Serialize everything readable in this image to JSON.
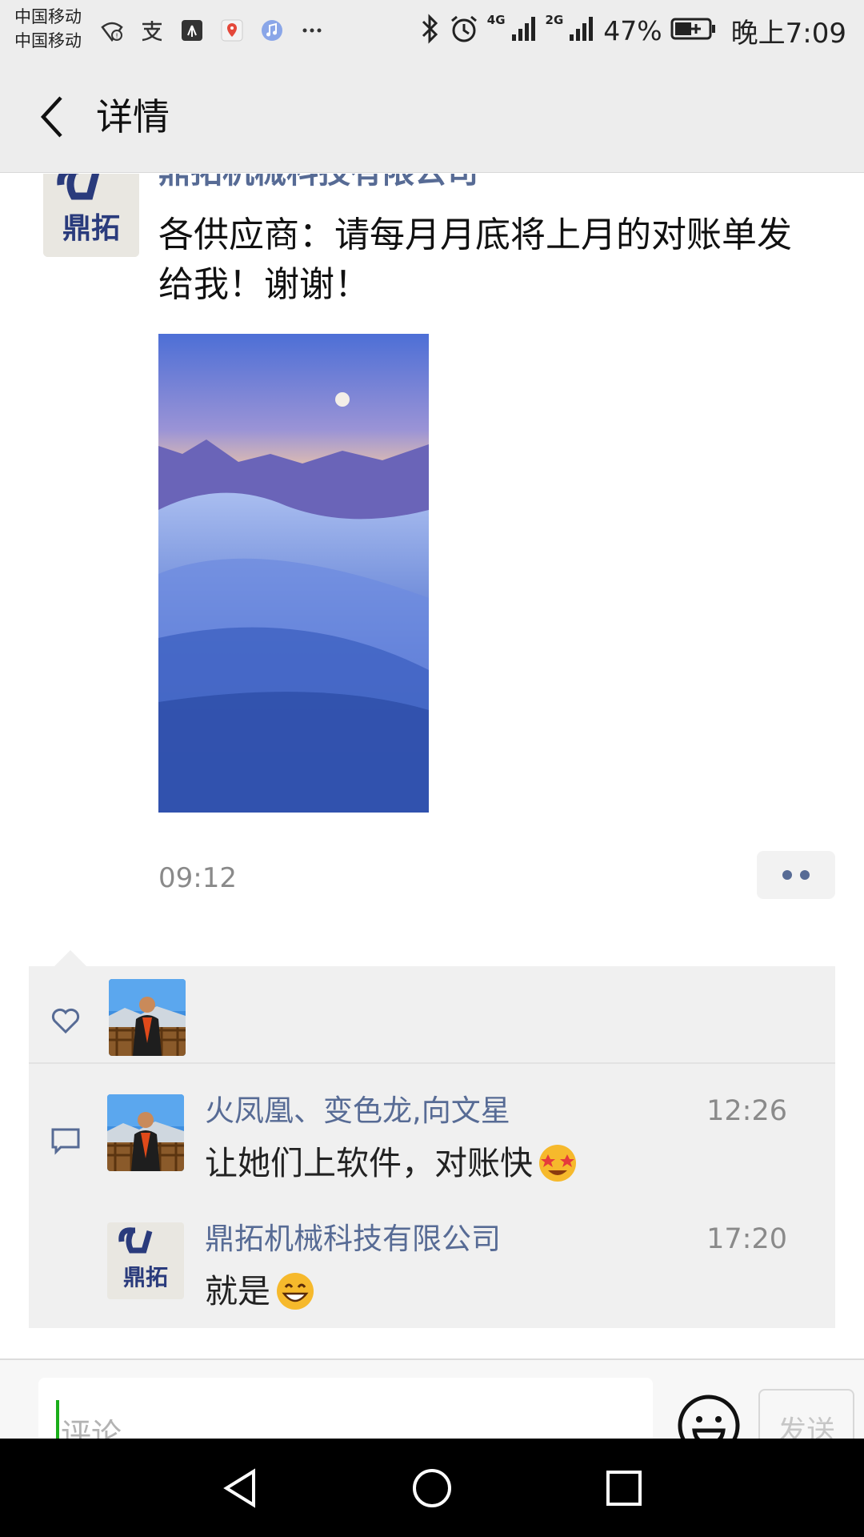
{
  "status_bar": {
    "carrier_1": "中国移动",
    "carrier_2": "中国移动",
    "left_icons": [
      "wifi-warning-icon",
      "alipay-icon",
      "huawei-app-icon",
      "map-app-icon",
      "music-app-icon",
      "more-dots-icon"
    ],
    "net_1": "4G",
    "net_2": "2G",
    "battery_percent": "47%",
    "time": "晚上7:09"
  },
  "nav": {
    "title": "详情"
  },
  "post": {
    "author": "鼎拓机械科技有限公司",
    "avatar_text": "鼎拓",
    "text": "各供应商：请每月月底将上月的对账单发给我！谢谢！",
    "time": "09:12"
  },
  "likes": {
    "count": 1
  },
  "comments": [
    {
      "name": "火凤凰、变色龙,向文星",
      "time": "12:26",
      "text": "让她们上软件，对账快",
      "emoji": "star-struck-emoji"
    },
    {
      "name": "鼎拓机械科技有限公司",
      "time": "17:20",
      "text": "就是",
      "emoji": "grinning-emoji"
    }
  ],
  "input": {
    "placeholder": "评论",
    "send_label": "发送"
  },
  "colors": {
    "link_blue": "#576b95",
    "panel_bg": "#f0f0f0",
    "header_bg": "#ededed",
    "caret_green": "#1aad19"
  }
}
